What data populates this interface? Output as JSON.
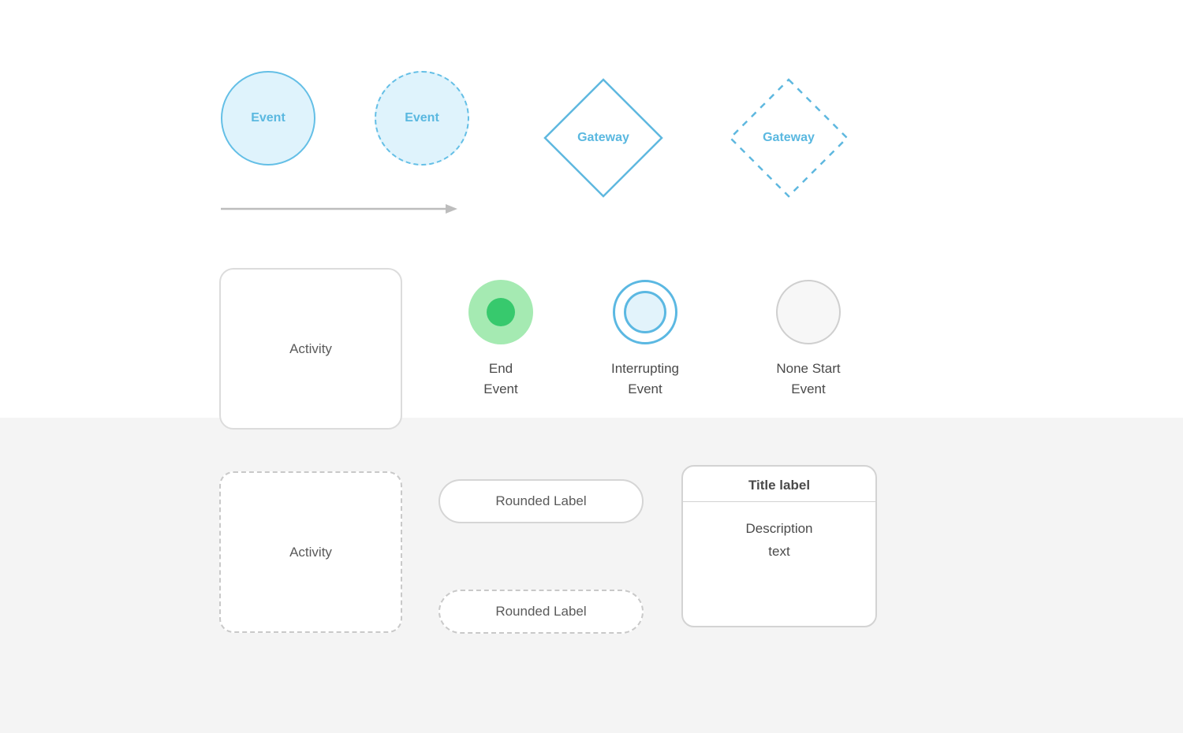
{
  "row1": {
    "event_solid_label": "Event",
    "event_dashed_label": "Event",
    "gateway_solid_label": "Gateway",
    "gateway_dashed_label": "Gateway"
  },
  "row2": {
    "activity_solid_label": "Activity",
    "end_event_line1": "End",
    "end_event_line2": "Event",
    "interrupting_line1": "Interrupting",
    "interrupting_line2": "Event",
    "none_start_line1": "None Start",
    "none_start_line2": "Event"
  },
  "row3": {
    "activity_dashed_label": "Activity",
    "pill_solid_label": "Rounded Label",
    "pill_dashed_label": "Rounded Label",
    "card_title": "Title label",
    "card_desc_line1": "Description",
    "card_desc_line2": "text"
  }
}
